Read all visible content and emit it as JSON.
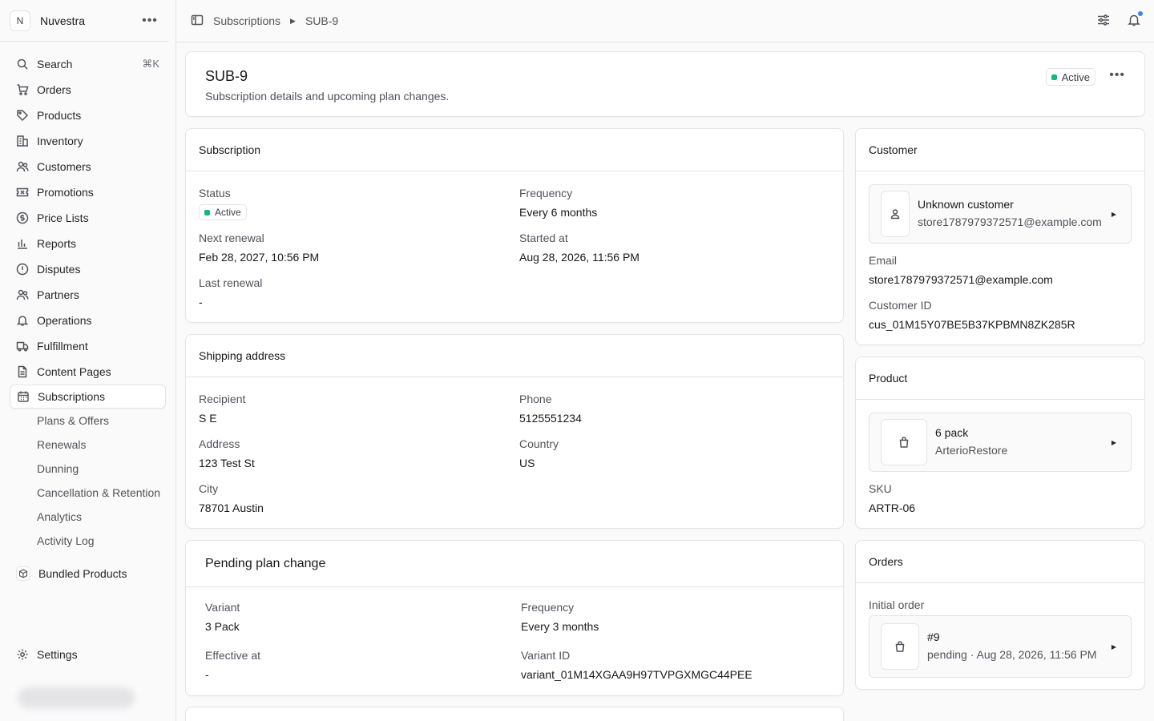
{
  "store": {
    "initial": "N",
    "name": "Nuvestra"
  },
  "nav": {
    "search": {
      "label": "Search",
      "shortcut": "⌘K"
    },
    "items": [
      {
        "label": "Orders",
        "icon": "cart-icon"
      },
      {
        "label": "Products",
        "icon": "tag-icon"
      },
      {
        "label": "Inventory",
        "icon": "building-icon"
      },
      {
        "label": "Customers",
        "icon": "users-icon"
      },
      {
        "label": "Promotions",
        "icon": "ticket-icon"
      },
      {
        "label": "Price Lists",
        "icon": "dollar-icon"
      },
      {
        "label": "Reports",
        "icon": "bar-chart-icon"
      },
      {
        "label": "Disputes",
        "icon": "alert-circle-icon"
      },
      {
        "label": "Partners",
        "icon": "users-icon"
      },
      {
        "label": "Operations",
        "icon": "bell-icon"
      },
      {
        "label": "Fulfillment",
        "icon": "truck-icon"
      },
      {
        "label": "Content Pages",
        "icon": "document-icon"
      }
    ],
    "active": {
      "label": "Subscriptions",
      "icon": "calendar-icon"
    },
    "subitems": [
      "Plans & Offers",
      "Renewals",
      "Dunning",
      "Cancellation & Retention",
      "Analytics",
      "Activity Log"
    ],
    "bundled": "Bundled Products",
    "settings": "Settings"
  },
  "breadcrumb": {
    "parent": "Subscriptions",
    "current": "SUB-9"
  },
  "header": {
    "title": "SUB-9",
    "subtitle": "Subscription details and upcoming plan changes.",
    "status": "Active"
  },
  "subscription": {
    "title": "Subscription",
    "status_label": "Status",
    "status_value": "Active",
    "frequency_label": "Frequency",
    "frequency_value": "Every 6 months",
    "next_renewal_label": "Next renewal",
    "next_renewal_value": "Feb 28, 2027, 10:56 PM",
    "started_label": "Started at",
    "started_value": "Aug 28, 2026, 11:56 PM",
    "last_renewal_label": "Last renewal",
    "last_renewal_value": "-"
  },
  "shipping": {
    "title": "Shipping address",
    "recipient_label": "Recipient",
    "recipient_value": "S E",
    "phone_label": "Phone",
    "phone_value": "5125551234",
    "address_label": "Address",
    "address_value": "123 Test St",
    "country_label": "Country",
    "country_value": "US",
    "city_label": "City",
    "city_value": "78701 Austin"
  },
  "pending": {
    "title": "Pending plan change",
    "variant_label": "Variant",
    "variant_value": "3 Pack",
    "frequency_label": "Frequency",
    "frequency_value": "Every 3 months",
    "effective_label": "Effective at",
    "effective_value": "-",
    "variant_id_label": "Variant ID",
    "variant_id_value": "variant_01M14XGAA9H97TVPGXMGC44PEE"
  },
  "customer": {
    "title": "Customer",
    "name": "Unknown customer",
    "email_line": "store1787979372571@example.com",
    "email_label": "Email",
    "email_value": "store1787979372571@example.com",
    "id_label": "Customer ID",
    "id_value": "cus_01M15Y07BE5B37KPBMN8ZK285R"
  },
  "product": {
    "title": "Product",
    "name": "6 pack",
    "brand": "ArterioRestore",
    "sku_label": "SKU",
    "sku_value": "ARTR-06"
  },
  "orders": {
    "title": "Orders",
    "initial_label": "Initial order",
    "order_number": "#9",
    "order_meta": "pending · Aug 28, 2026, 11:56 PM"
  },
  "colors": {
    "active_dot": "#10b981",
    "notification_dot": "#3b82f6"
  }
}
